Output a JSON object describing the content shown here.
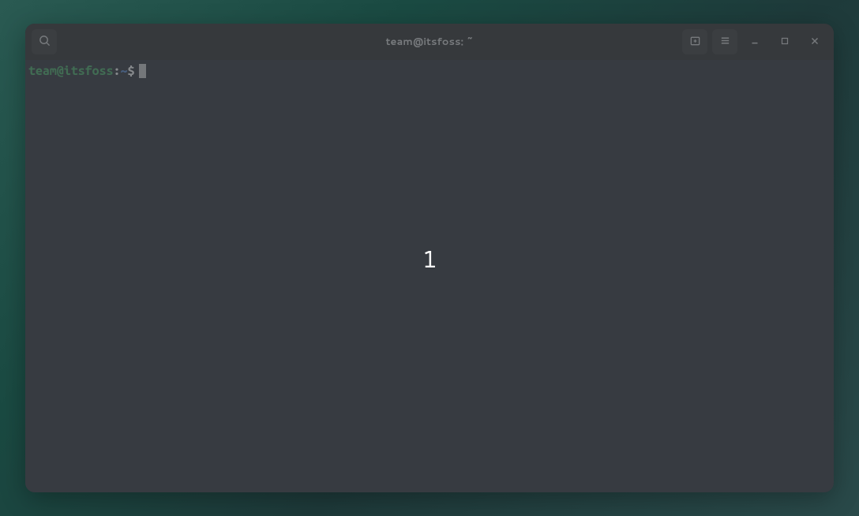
{
  "window": {
    "title": "team@itsfoss: ~"
  },
  "prompt": {
    "user": "team",
    "at": "@",
    "host": "itsfoss",
    "colon": ":",
    "path": "~",
    "dollar": "$"
  },
  "overlay": {
    "number": "1"
  }
}
